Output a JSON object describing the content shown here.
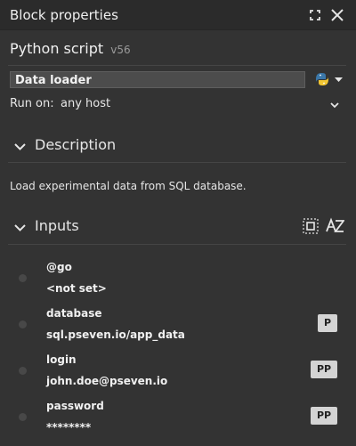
{
  "panel": {
    "title": "Block properties",
    "maximize_icon": "maximize-icon",
    "close_icon": "close-icon"
  },
  "block": {
    "type": "Python script",
    "version": "v56",
    "name": "Data loader",
    "language_icon": "python-icon",
    "run_on_label": "Run on:",
    "run_on_value": "any host"
  },
  "description": {
    "header": "Description",
    "text": "Load experimental data from SQL database."
  },
  "inputs": {
    "header": "Inputs",
    "tools": [
      "select-all-icon",
      "sort-az-icon"
    ],
    "items": [
      {
        "name": "@go",
        "value": "<not set>",
        "badge": ""
      },
      {
        "name": "database",
        "value": "sql.pseven.io/app_data",
        "badge": "P"
      },
      {
        "name": "login",
        "value": "john.doe@pseven.io",
        "badge": "PP"
      },
      {
        "name": "password",
        "value": "********",
        "badge": "PP"
      }
    ]
  },
  "colors": {
    "background": "#333333",
    "titlebar": "#2b2b2b",
    "badge": "#d4d4d4",
    "python_blue": "#3b77a8",
    "python_yellow": "#f2c632"
  }
}
